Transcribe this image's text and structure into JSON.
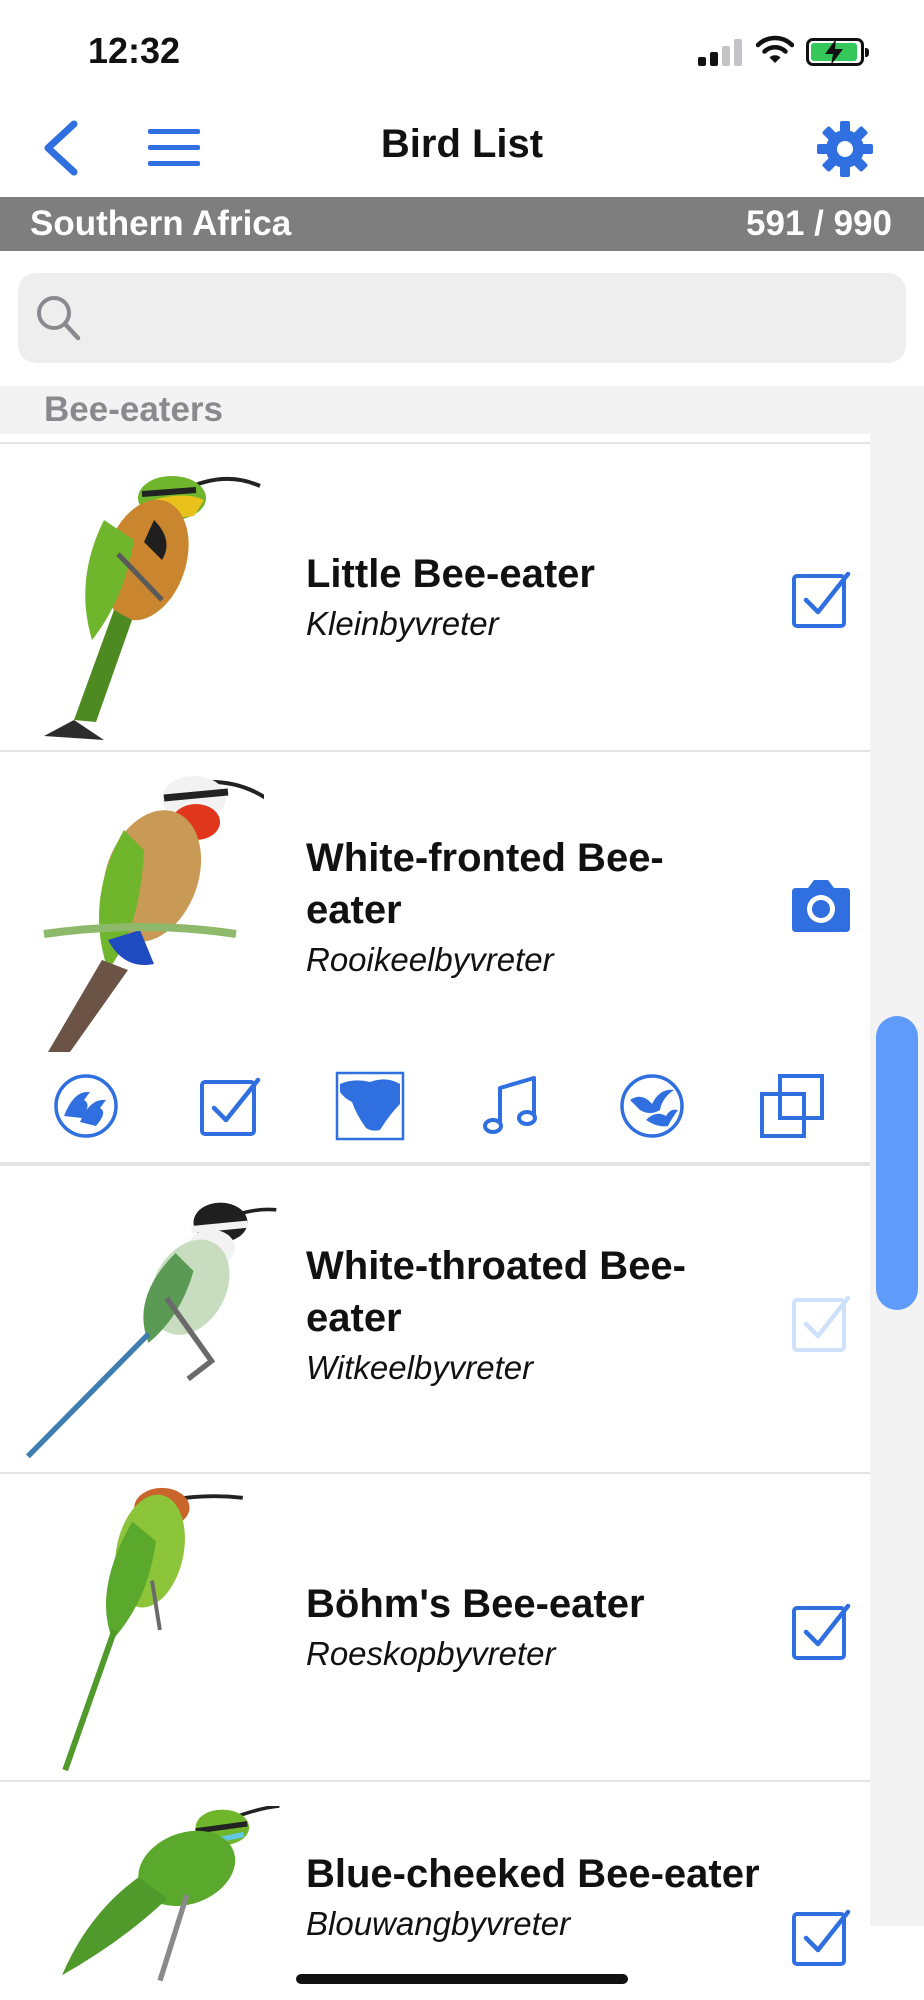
{
  "status_bar": {
    "time": "12:32",
    "battery_color": "#34c759"
  },
  "nav": {
    "title": "Bird List",
    "back_icon": "chevron-left-icon",
    "menu_icon": "hamburger-menu-icon",
    "settings_icon": "gear-icon",
    "accent_color": "#2f6fe0"
  },
  "region": {
    "name": "Southern Africa",
    "count": "591 / 990"
  },
  "search": {
    "placeholder": "",
    "value": ""
  },
  "section": {
    "title": "Bee-eaters"
  },
  "birds": [
    {
      "common_name": "Little Bee-eater",
      "afrikaans_name": "Kleinbyvreter",
      "status": "seen",
      "status_icon": "checkbox-checked-icon"
    },
    {
      "common_name": "White-fronted Bee-eater",
      "afrikaans_name": "Rooikeelbyvreter",
      "status": "photographed",
      "status_icon": "camera-icon"
    },
    {
      "common_name": "White-throated Bee-eater",
      "afrikaans_name": "Witkeelbyvreter",
      "status": "not-seen",
      "status_icon": "checkbox-faded-icon"
    },
    {
      "common_name": "Böhm's Bee-eater",
      "afrikaans_name": "Roeskopbyvreter",
      "status": "seen",
      "status_icon": "checkbox-checked-icon"
    },
    {
      "common_name": "Blue-cheeked Bee-eater",
      "afrikaans_name": "Blouwangbyvreter",
      "status": "seen",
      "status_icon": "checkbox-checked-icon"
    }
  ],
  "toolbar": {
    "icons": [
      "birds-pair-icon",
      "checkbox-icon",
      "distribution-map-icon",
      "music-note-icon",
      "birds-flight-icon",
      "copy-icon"
    ]
  }
}
